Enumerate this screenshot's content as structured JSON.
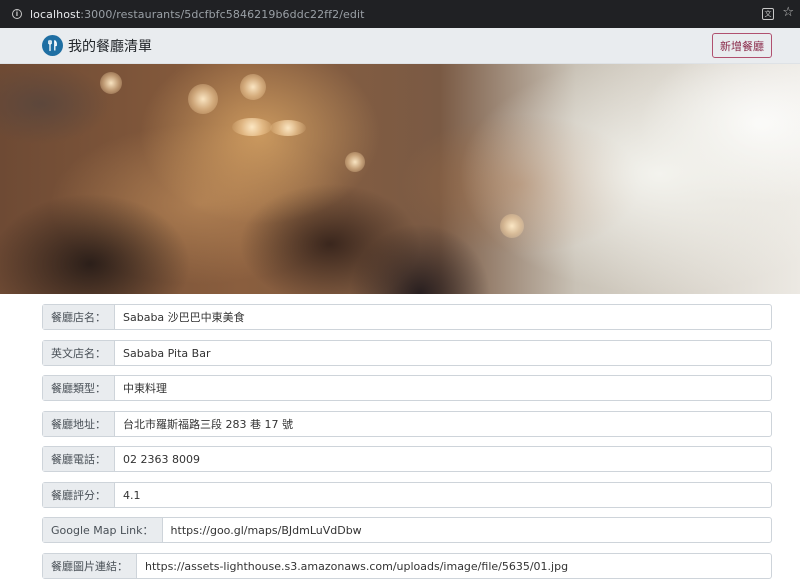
{
  "browser": {
    "url_host": "localhost",
    "url_rest": ":3000/restaurants/5dcfbfc5846219b6ddc22ff2/edit"
  },
  "navbar": {
    "brand_title": "我的餐廳清單",
    "logo_icon": "utensils-icon",
    "add_button_label": "新增餐廳",
    "accent_color": "#8a2a4a"
  },
  "form": {
    "fields": [
      {
        "label": "餐廳店名：",
        "value": "Sababa 沙巴巴中東美食"
      },
      {
        "label": "英文店名：",
        "value": "Sababa Pita Bar"
      },
      {
        "label": "餐廳類型：",
        "value": "中東料理"
      },
      {
        "label": "餐廳地址：",
        "value": "台北市羅斯福路三段 283 巷 17 號"
      },
      {
        "label": "餐廳電話：",
        "value": "02 2363 8009"
      },
      {
        "label": "餐廳評分：",
        "value": "4.1"
      },
      {
        "label": "Google Map Link：",
        "value": "https://goo.gl/maps/BJdmLuVdDbw"
      },
      {
        "label": "餐廳圖片連結：",
        "value": "https://assets-lighthouse.s3.amazonaws.com/uploads/image/file/5635/01.jpg"
      }
    ]
  }
}
